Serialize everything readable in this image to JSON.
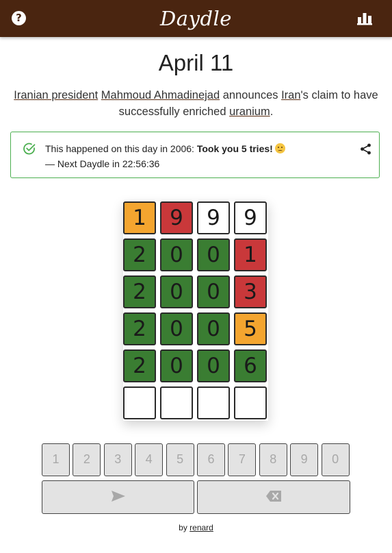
{
  "header": {
    "help_label": "?",
    "logo": "Daydle",
    "stats_icon": "bar-chart-icon"
  },
  "title": "April 11",
  "event": {
    "parts": [
      {
        "text": "Iranian president",
        "link": true
      },
      {
        "text": " ",
        "link": false
      },
      {
        "text": "Mahmoud Ahmadinejad",
        "link": true
      },
      {
        "text": " announces ",
        "link": false
      },
      {
        "text": "Iran",
        "link": true
      },
      {
        "text": "'s claim to have successfully enriched ",
        "link": false
      },
      {
        "text": "uranium",
        "link": true
      },
      {
        "text": ".",
        "link": false
      }
    ]
  },
  "result": {
    "prefix": "This happened on this day in 2006: ",
    "bold": "Took you 5 tries!",
    "emoji": "disappointed-face",
    "next": "— Next Daydle in 22:56:36",
    "check_icon": "check-circle-icon",
    "share_icon": "share-icon"
  },
  "grid": {
    "rows": [
      [
        {
          "d": "1",
          "s": "orange"
        },
        {
          "d": "9",
          "s": "red"
        },
        {
          "d": "9",
          "s": "white"
        },
        {
          "d": "9",
          "s": "white"
        }
      ],
      [
        {
          "d": "2",
          "s": "green"
        },
        {
          "d": "0",
          "s": "green"
        },
        {
          "d": "0",
          "s": "green"
        },
        {
          "d": "1",
          "s": "red"
        }
      ],
      [
        {
          "d": "2",
          "s": "green"
        },
        {
          "d": "0",
          "s": "green"
        },
        {
          "d": "0",
          "s": "green"
        },
        {
          "d": "3",
          "s": "red"
        }
      ],
      [
        {
          "d": "2",
          "s": "green"
        },
        {
          "d": "0",
          "s": "green"
        },
        {
          "d": "0",
          "s": "green"
        },
        {
          "d": "5",
          "s": "orange"
        }
      ],
      [
        {
          "d": "2",
          "s": "green"
        },
        {
          "d": "0",
          "s": "green"
        },
        {
          "d": "0",
          "s": "green"
        },
        {
          "d": "6",
          "s": "green"
        }
      ],
      [
        {
          "d": "",
          "s": "white"
        },
        {
          "d": "",
          "s": "white"
        },
        {
          "d": "",
          "s": "white"
        },
        {
          "d": "",
          "s": "white"
        }
      ]
    ]
  },
  "colors": {
    "header": "#4a2510",
    "orange": "#f4a52f",
    "red": "#c9383a",
    "green": "#3a7d32",
    "white": "#ffffff",
    "success_border": "#4caf50"
  },
  "keyboard": {
    "digits": [
      "1",
      "2",
      "3",
      "4",
      "5",
      "6",
      "7",
      "8",
      "9",
      "0"
    ],
    "enter_icon": "send-icon",
    "backspace_icon": "backspace-icon"
  },
  "footer": {
    "by": "by ",
    "author": "renard"
  }
}
